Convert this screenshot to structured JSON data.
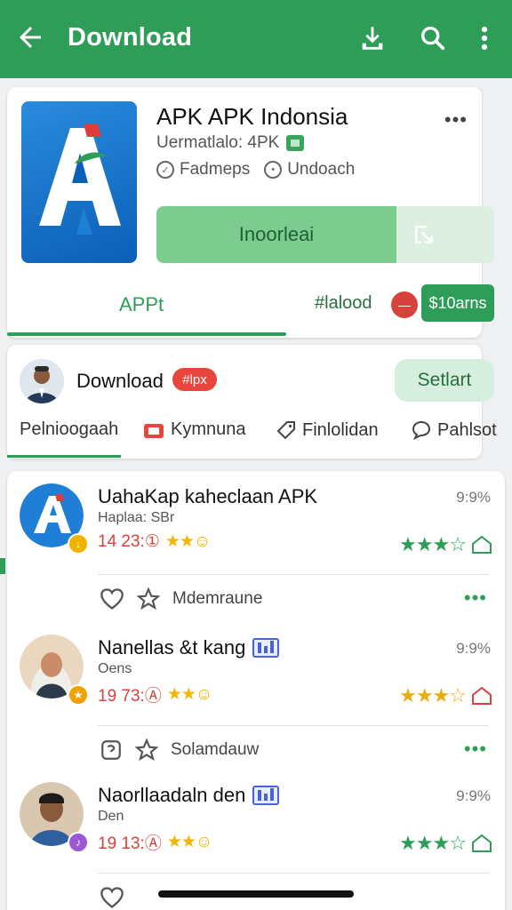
{
  "appbar": {
    "title": "Download",
    "icons": [
      "back-arrow-icon",
      "download-icon",
      "search-icon",
      "more-vert-icon"
    ]
  },
  "app": {
    "name": "APK APK Indonsia",
    "meta1": "Uermatlalo: 4PK",
    "meta2a": "Fadmeps",
    "meta2b": "Undoach",
    "install_label": "Inoorleai",
    "tabs": {
      "apps": "APPt",
      "download": "#lalood",
      "price": "$10arns"
    }
  },
  "developer": {
    "name": "Download",
    "chip": "#lpx",
    "start_label": "Setlart",
    "categories": [
      "Pelnioogaah",
      "Kymnuna",
      "Finlolidan",
      "Pahlsot"
    ]
  },
  "list": [
    {
      "title": "UahaKap kaheclaan APK",
      "sub": "Haplaa: SBr",
      "meta": "14 23:①",
      "time": "9:9%",
      "action": "Mdemraune",
      "action_icon": "heart-icon"
    },
    {
      "title": "Nanellas &t kang",
      "sub": "Oens",
      "meta": "19 73:Ⓐ",
      "time": "9:9%",
      "action": "Solamdauw",
      "action_icon": "badge-icon"
    },
    {
      "title": "Naorllaadaln  den",
      "sub": "Den",
      "meta": "19 13:Ⓐ",
      "time": "9:9%",
      "action": "",
      "action_icon": "heart-icon"
    }
  ],
  "colors": {
    "primary": "#2e9d57",
    "accent_red": "#d8423c",
    "star_gold": "#f4b400"
  }
}
